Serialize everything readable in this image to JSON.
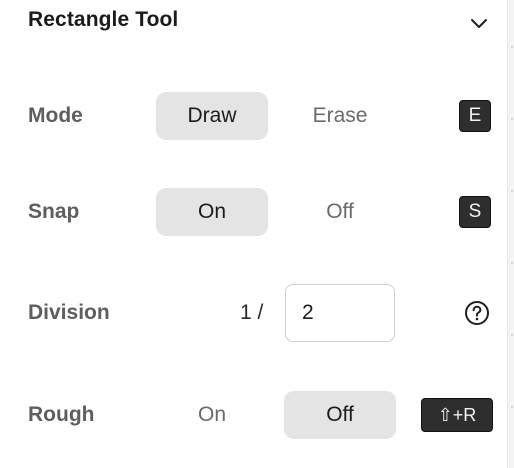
{
  "panel": {
    "title": "Rectangle Tool"
  },
  "icons": {
    "collapse": "chevron-down-icon",
    "help": "question-circle-icon"
  },
  "mode": {
    "label": "Mode",
    "options": [
      "Draw",
      "Erase"
    ],
    "selected": "Draw",
    "shortcut": "E"
  },
  "snap": {
    "label": "Snap",
    "options": [
      "On",
      "Off"
    ],
    "selected": "On",
    "shortcut": "S"
  },
  "division": {
    "label": "Division",
    "prefix": "1 /",
    "value": "2"
  },
  "rough": {
    "label": "Rough",
    "options": [
      "On",
      "Off"
    ],
    "selected": "Off",
    "shortcut": "⇧+R"
  },
  "colors": {
    "active_segment_bg": "#e4e4e4",
    "label_gray": "#5e5e5e",
    "key_bg": "#2e2e2e"
  }
}
